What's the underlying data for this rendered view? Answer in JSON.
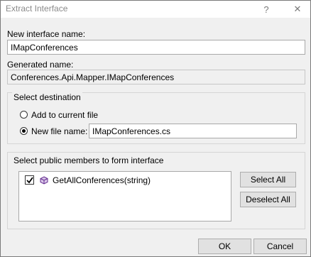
{
  "window": {
    "title": "Extract Interface",
    "help_glyph": "?",
    "close_glyph": "✕"
  },
  "form": {
    "interface_name_label": "New interface name:",
    "interface_name_value": "IMapConferences",
    "generated_name_label": "Generated name:",
    "generated_name_value": "Conferences.Api.Mapper.IMapConferences"
  },
  "destination": {
    "group_label": "Select destination",
    "option_current_file": "Add to current file",
    "option_new_file": "New file name:",
    "selected": "new_file",
    "new_file_value": "IMapConferences.cs"
  },
  "members": {
    "group_label": "Select public members to form interface",
    "items": [
      {
        "label": "GetAllConferences(string)",
        "checked": true,
        "icon": "method-cube-icon"
      }
    ],
    "select_all_label": "Select All",
    "deselect_all_label": "Deselect All"
  },
  "footer": {
    "ok_label": "OK",
    "cancel_label": "Cancel"
  },
  "colors": {
    "method_icon": "#652d90",
    "dialog_bg": "#f0f0f0"
  }
}
